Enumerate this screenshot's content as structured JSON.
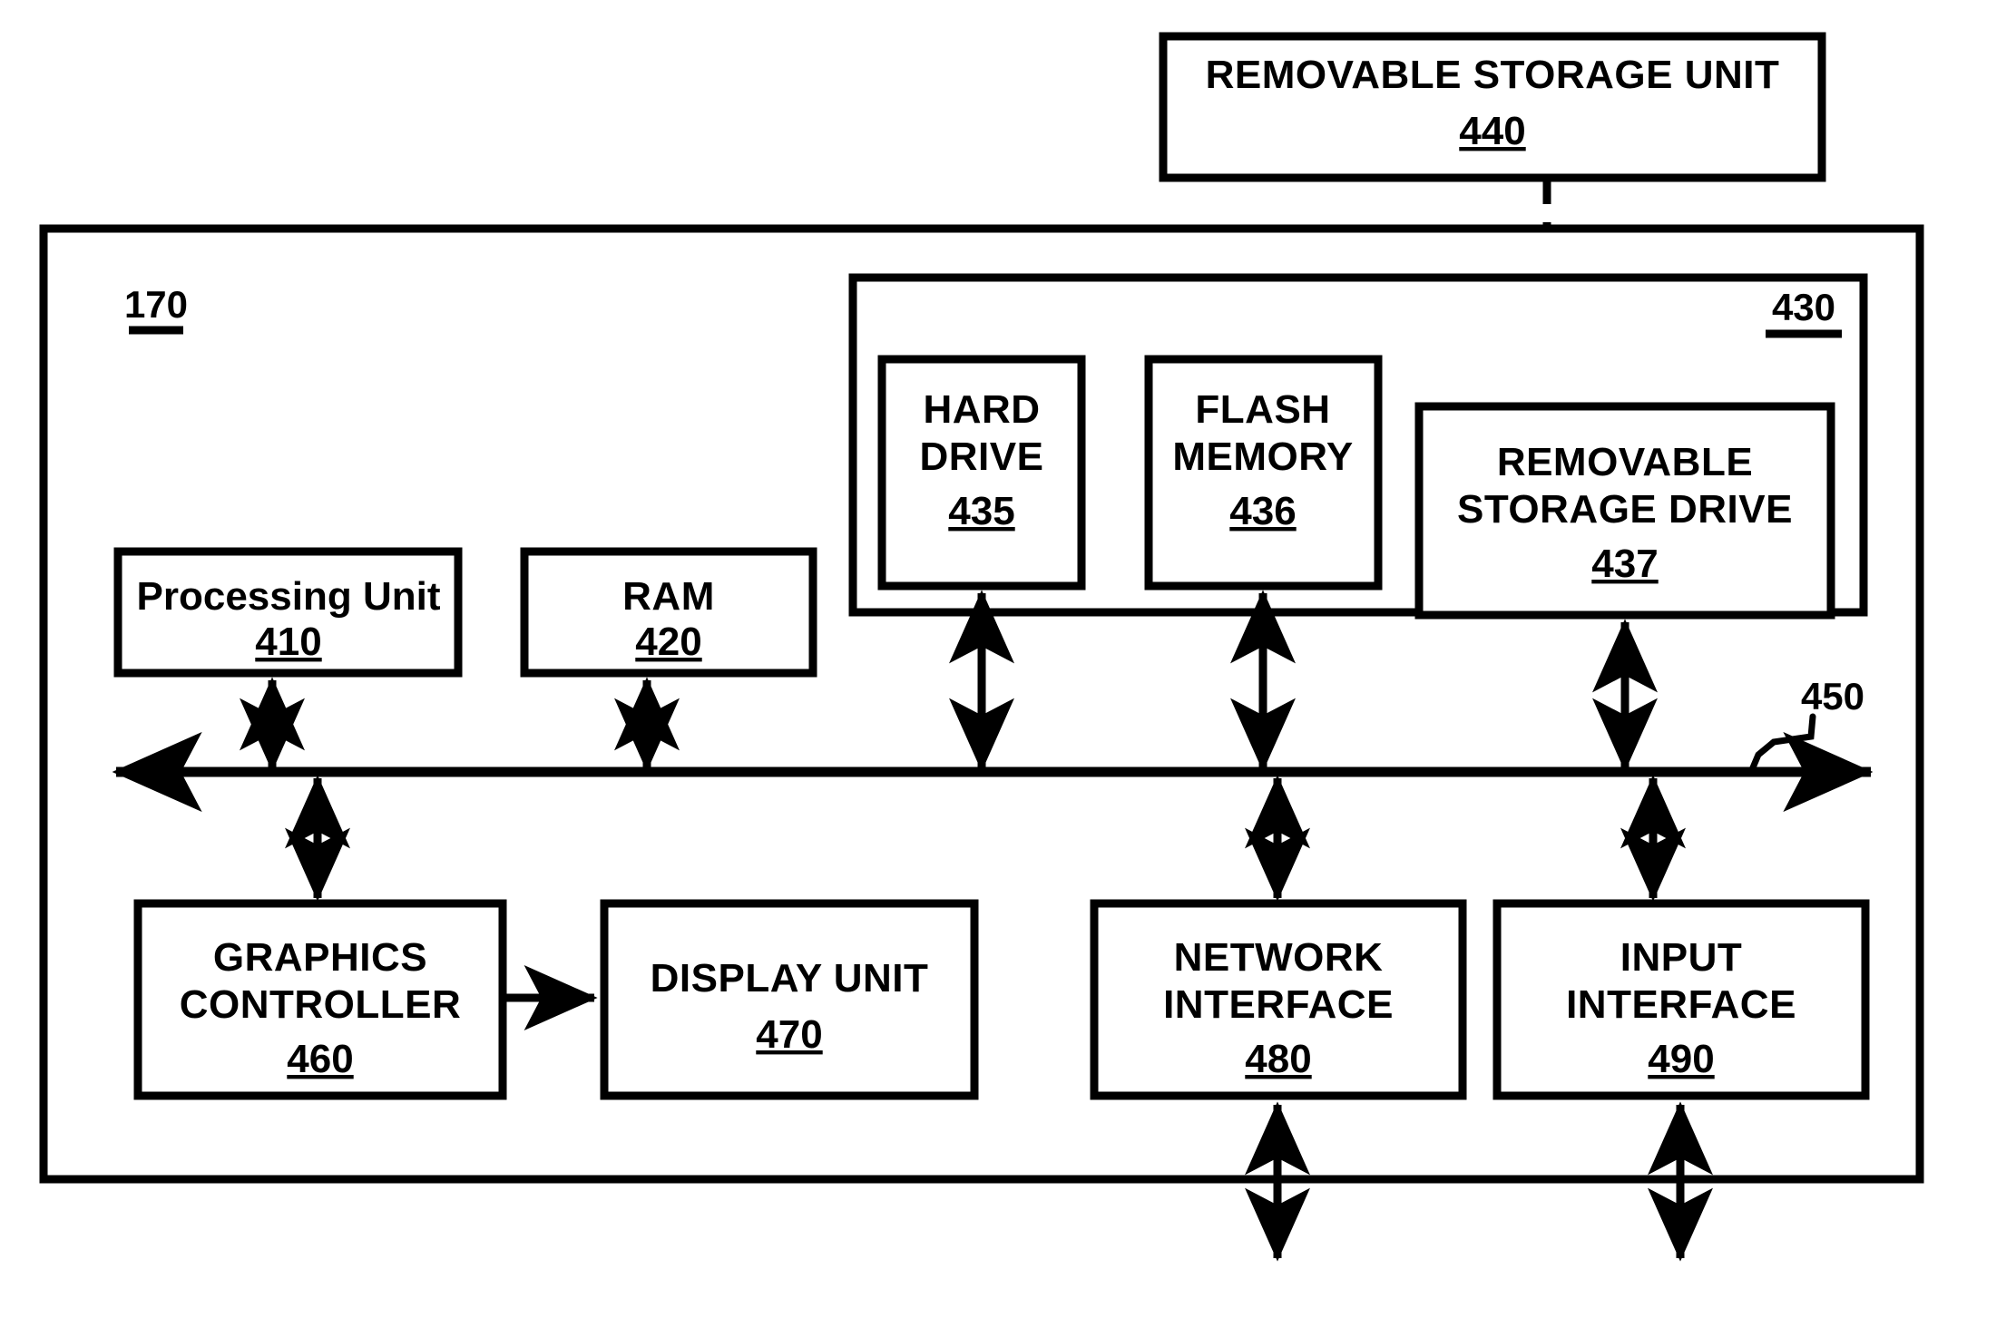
{
  "figure": {
    "kind": "patent-block-diagram",
    "stroke_color": "#000000",
    "background_color": "#ffffff"
  },
  "outer_system": {
    "ref": "170"
  },
  "storage_group": {
    "ref": "430"
  },
  "removable_storage_unit": {
    "title": "REMOVABLE STORAGE UNIT",
    "ref": "440"
  },
  "boxes": {
    "processing_unit": {
      "line1": "Processing Unit",
      "ref": "410"
    },
    "ram": {
      "line1": "RAM",
      "ref": "420"
    },
    "hard_drive": {
      "line1": "HARD",
      "line2": "DRIVE",
      "ref": "435"
    },
    "flash_memory": {
      "line1": "FLASH",
      "line2": "MEMORY",
      "ref": "436"
    },
    "removable_storage_drive": {
      "line1": "REMOVABLE",
      "line2": "STORAGE DRIVE",
      "ref": "437"
    },
    "graphics_controller": {
      "line1": "GRAPHICS",
      "line2": "CONTROLLER",
      "ref": "460"
    },
    "display_unit": {
      "line1": "DISPLAY UNIT",
      "ref": "470"
    },
    "network_interface": {
      "line1": "NETWORK",
      "line2": "INTERFACE",
      "ref": "480"
    },
    "input_interface": {
      "line1": "INPUT",
      "line2": "INTERFACE",
      "ref": "490"
    }
  },
  "bus": {
    "ref": "450"
  }
}
